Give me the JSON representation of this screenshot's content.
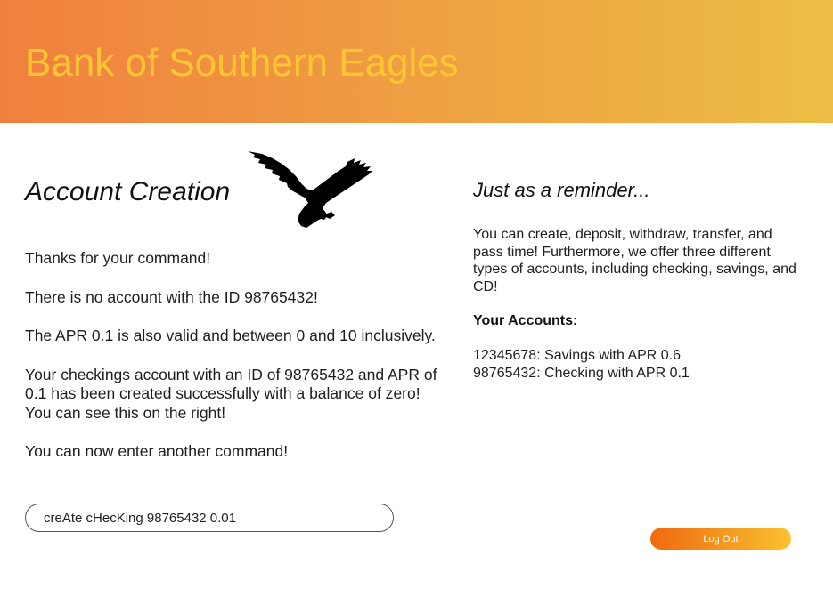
{
  "header": {
    "bank_name": "Bank of Southern Eagles"
  },
  "main": {
    "section_title": "Account Creation",
    "logo_icon": "eagle-icon",
    "messages": [
      "Thanks for your command!",
      "There is no account with the ID 98765432!",
      "The APR 0.1 is also valid and between 0 and 10 inclusively.",
      "Your checkings account with an ID of 98765432 and APR of 0.1 has been created successfully with a balance of zero! You can see this on the right!",
      "You can now enter another command!"
    ],
    "command_input": {
      "value": "creAte cHecKing 98765432 0.01",
      "placeholder": ""
    }
  },
  "sidebar": {
    "reminder_title": "Just as a reminder...",
    "reminder_text": "You can create, deposit, withdraw, transfer, and pass time! Furthermore, we offer three different types of accounts, including checking, savings, and CD!",
    "accounts_heading": "Your Accounts:",
    "accounts": [
      "12345678: Savings with APR 0.6",
      "98765432: Checking with APR 0.1"
    ],
    "logout_label": "Log Out"
  },
  "colors": {
    "header_gradient_start": "#f0803e",
    "header_gradient_end": "#ecbe44",
    "bank_name_color": "#fcc531",
    "logout_gradient_start": "#ef6a10",
    "logout_gradient_end": "#fcc030"
  }
}
